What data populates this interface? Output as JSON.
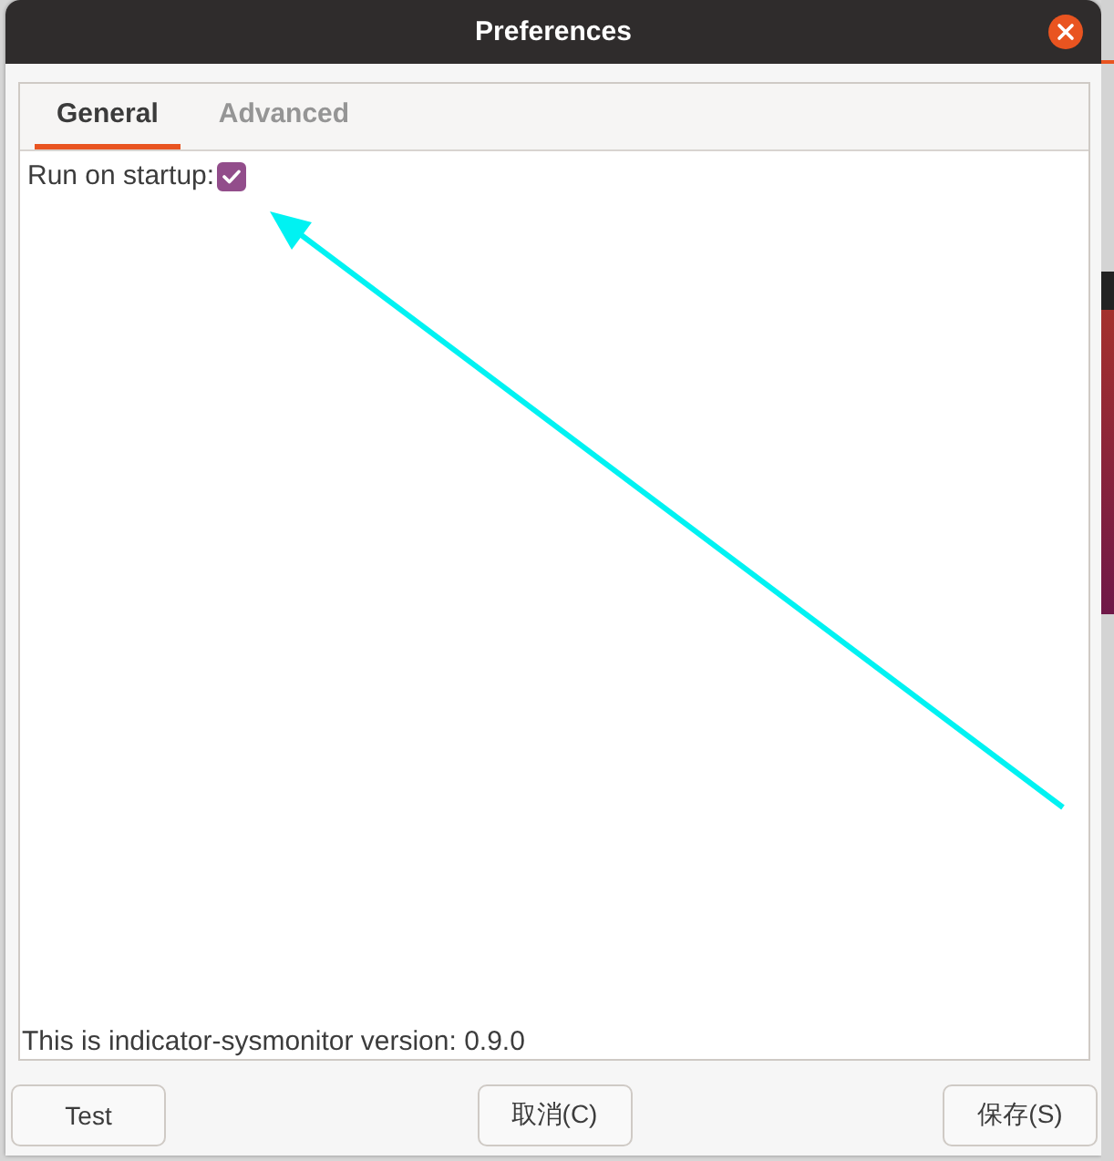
{
  "window": {
    "title": "Preferences"
  },
  "tabs": [
    {
      "label": "General",
      "selected": true
    },
    {
      "label": "Advanced",
      "selected": false
    }
  ],
  "general": {
    "run_on_startup": {
      "label": "Run on startup:",
      "checked": true
    }
  },
  "footer_text": "This is indicator-sysmonitor version: 0.9.0",
  "buttons": [
    {
      "label": "Test"
    },
    {
      "label": "取消(C)"
    },
    {
      "label": "保存(S)"
    }
  ]
}
